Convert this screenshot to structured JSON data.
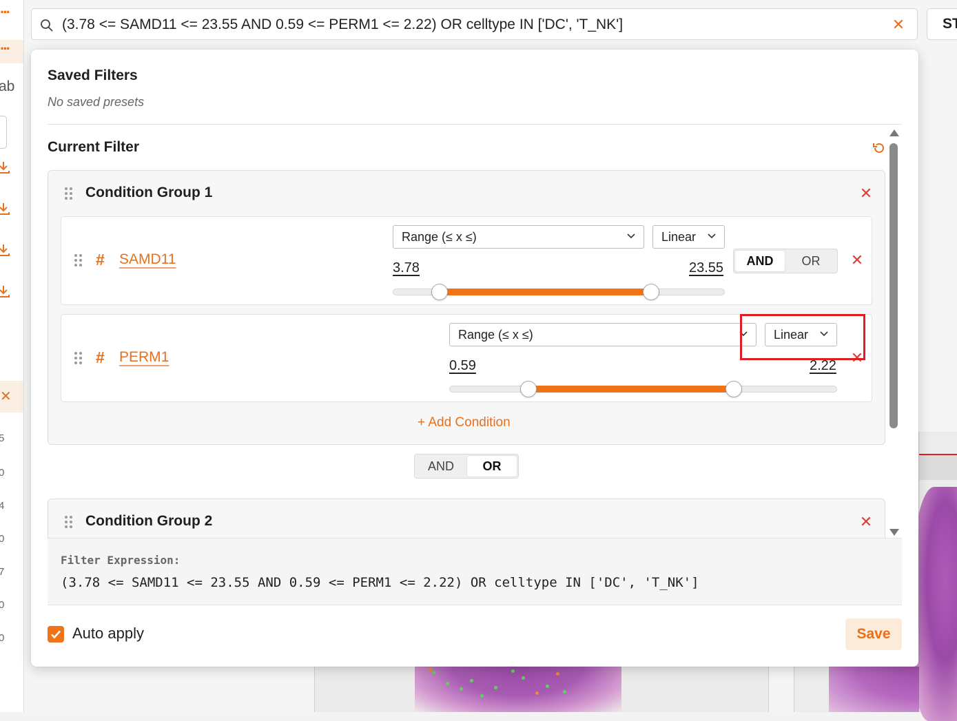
{
  "search": {
    "query": "(3.78 <= SAMD11 <= 23.55 AND 0.59 <= PERM1 <= 2.22) OR celltype IN ['DC', 'T_NK']",
    "clear_icon": "close-icon"
  },
  "header": {
    "st_label": "ST"
  },
  "left_rail": {
    "partial_text": "ab",
    "digits": [
      "5",
      "0",
      "4",
      "0",
      "7",
      "0",
      "0"
    ]
  },
  "saved_filters": {
    "title": "Saved Filters",
    "empty_text": "No saved presets"
  },
  "current_filter": {
    "title": "Current Filter",
    "groups": [
      {
        "title": "Condition Group 1",
        "conditions": [
          {
            "field": "SAMD11",
            "field_icon": "#",
            "mode": "Range (≤ x ≤)",
            "scale": "Linear",
            "min_label": "3.78",
            "max_label": "23.55",
            "range_fraction": [
              0.141,
              0.778
            ],
            "combinator": {
              "options": [
                "AND",
                "OR"
              ],
              "selected": "AND"
            }
          },
          {
            "field": "PERM1",
            "field_icon": "#",
            "mode": "Range (≤ x ≤)",
            "scale": "Linear",
            "min_label": "0.59",
            "max_label": "2.22",
            "range_fraction": [
              0.205,
              0.733
            ]
          }
        ],
        "add_condition_label": "+ Add Condition"
      },
      {
        "title": "Condition Group 2"
      }
    ],
    "group_combinator": {
      "options": [
        "AND",
        "OR"
      ],
      "selected": "OR"
    }
  },
  "expression": {
    "label": "Filter Expression:",
    "text": "(3.78 <= SAMD11 <= 23.55 AND 0.59 <= PERM1 <= 2.22) OR celltype IN ['DC', 'T_NK']"
  },
  "footer": {
    "auto_apply_label": "Auto apply",
    "auto_apply_checked": true,
    "save_label": "Save"
  },
  "colors": {
    "accent": "#f07318",
    "danger": "#e23b3b",
    "highlight": "#e11d24"
  }
}
